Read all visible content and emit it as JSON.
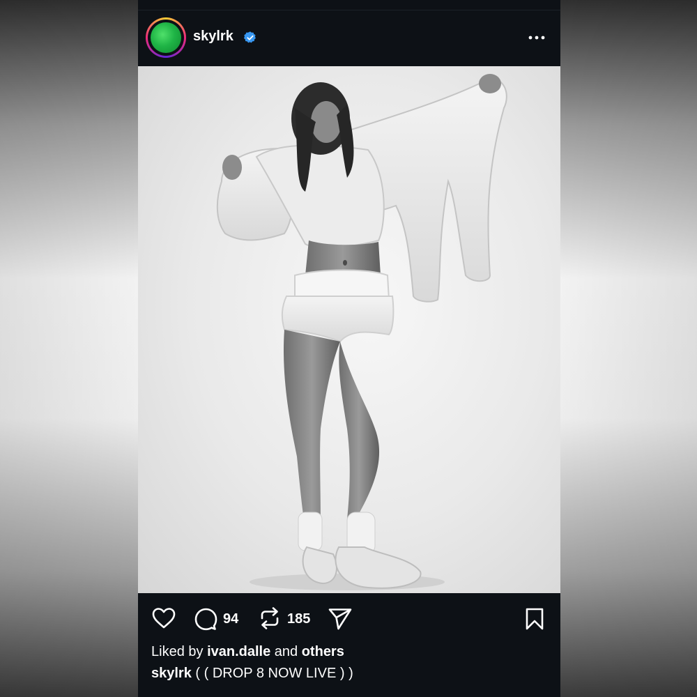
{
  "post": {
    "username": "skylrk",
    "verified": true,
    "icons": {
      "verified": "verified-badge-icon",
      "more": "more-options-icon",
      "like": "heart-icon",
      "comment": "comment-icon",
      "repost": "repost-icon",
      "share": "send-icon",
      "save": "bookmark-icon"
    },
    "photo_description_type": "black-and-white fashion photo",
    "comment_count": "94",
    "repost_count": "185",
    "liked_by": {
      "prefix": "Liked by",
      "user": "ivan.dalle",
      "connector": "and",
      "others": "others"
    },
    "caption": {
      "author": "skylrk",
      "text": "( ( DROP 8 NOW LIVE ) )"
    }
  },
  "colors": {
    "background": "#0d1116",
    "text": "#ffffff",
    "verified_blue": "#3897f0",
    "avatar_green": "#1fb446"
  }
}
